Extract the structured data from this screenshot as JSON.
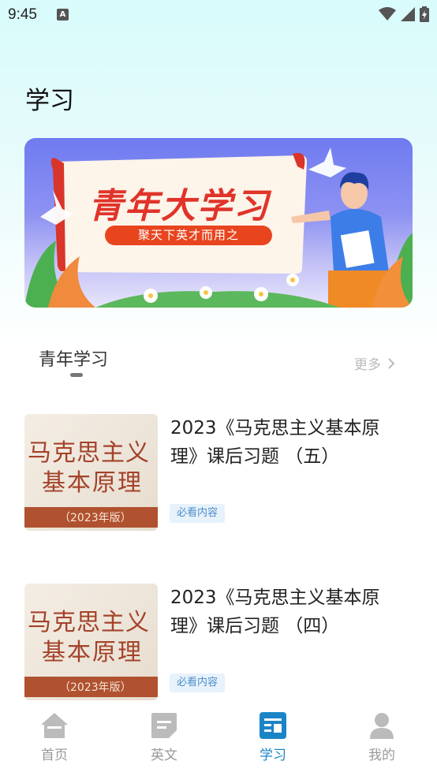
{
  "status": {
    "time": "9:45",
    "a_icon": "A"
  },
  "page": {
    "title": "学习"
  },
  "banner": {
    "title": "青年大学习",
    "subtitle": "聚天下英才而用之"
  },
  "section": {
    "title": "青年学习",
    "more": "更多"
  },
  "items": [
    {
      "title": "2023《马克思主义基本原理》课后习题 （五）",
      "tag": "必看内容",
      "thumb": {
        "line1": "马克思主义",
        "line2": "基本原理",
        "band": "（2023年版）"
      }
    },
    {
      "title": "2023《马克思主义基本原理》课后习题 （四）",
      "tag": "必看内容",
      "thumb": {
        "line1": "马克思主义",
        "line2": "基本原理",
        "band": "（2023年版）"
      }
    }
  ],
  "nav": [
    {
      "label": "首页",
      "icon": "home-icon"
    },
    {
      "label": "英文",
      "icon": "document-icon"
    },
    {
      "label": "学习",
      "icon": "study-icon",
      "active": true
    },
    {
      "label": "我的",
      "icon": "user-icon"
    }
  ],
  "colors": {
    "active": "#1a85c6",
    "inactive": "#999999",
    "banner_red": "#e0342a"
  }
}
